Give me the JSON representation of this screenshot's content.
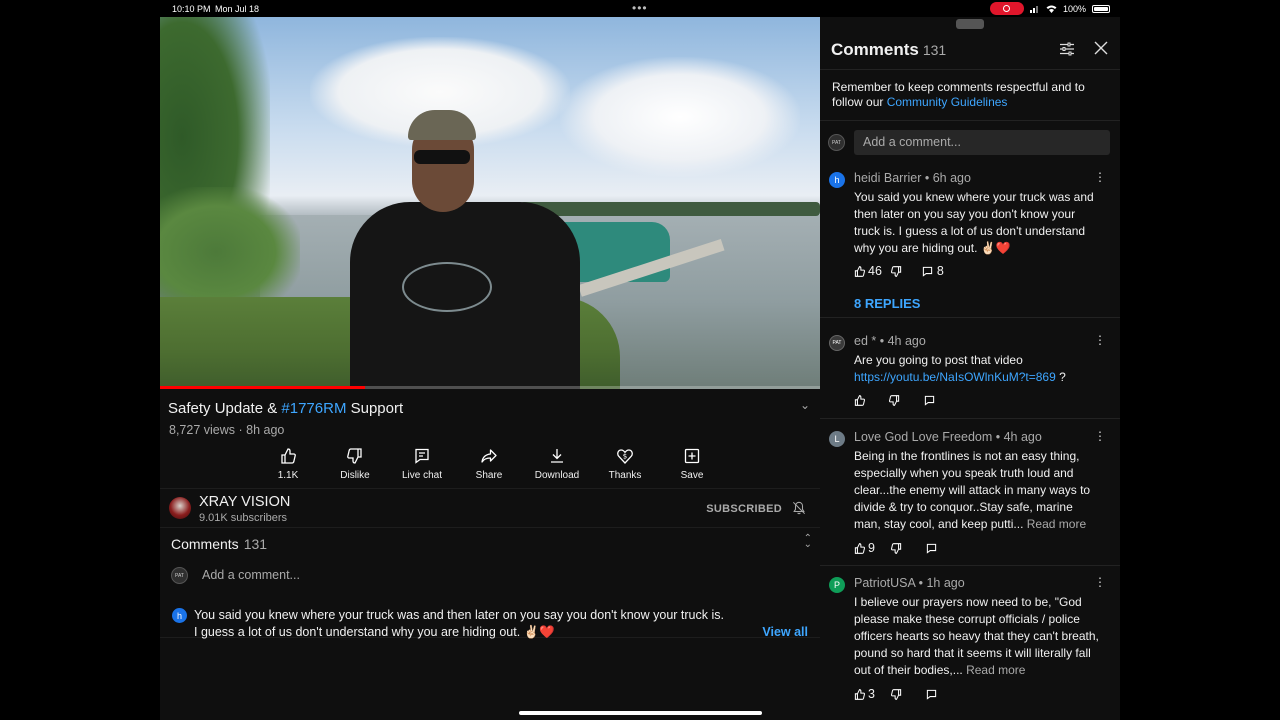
{
  "status": {
    "time": "10:10 PM",
    "date": "Mon Jul 18",
    "battery": "100%"
  },
  "video": {
    "progress_percent": 31,
    "title_prefix": "Safety Update & ",
    "title_tag": "#1776RM",
    "title_suffix": " Support",
    "meta": "8,727 views · 8h ago"
  },
  "actions": [
    {
      "label": "1.1K",
      "icon": "thumbs-up-icon"
    },
    {
      "label": "Dislike",
      "icon": "thumbs-down-icon"
    },
    {
      "label": "Live chat",
      "icon": "chat-icon"
    },
    {
      "label": "Share",
      "icon": "share-icon"
    },
    {
      "label": "Download",
      "icon": "download-icon"
    },
    {
      "label": "Thanks",
      "icon": "thanks-icon"
    },
    {
      "label": "Save",
      "icon": "save-icon"
    }
  ],
  "channel": {
    "name": "XRAY VISION",
    "subs": "9.01K subscribers",
    "subscribed_label": "SUBSCRIBED"
  },
  "comments_box": {
    "title": "Comments",
    "count": "131",
    "add_placeholder": "Add a comment...",
    "first_avatar_letter": "h",
    "first_text_line1": "You said you knew where your truck was and then later on you say you don't know your truck is.",
    "first_text_line2": "I guess a lot of us don't understand why you are hiding out. ✌🏻❤️",
    "view_all": "View all"
  },
  "panel": {
    "title": "Comments",
    "count": "131",
    "rules_text": "Remember to keep comments respectful and to follow our ",
    "rules_link": "Community Guidelines",
    "add_placeholder": "Add a comment...",
    "comments": [
      {
        "avatar_letter": "h",
        "avatar_color": "#1a73e8",
        "author": "heidi Barrier • 6h ago",
        "text": "You said you knew where your truck was and then later on you say you don't know your truck is.  I guess a lot of us don't understand why you are hiding out. ✌🏻❤️",
        "likes": "46",
        "reply_count": "8",
        "replies_label": "8 REPLIES"
      },
      {
        "avatar_letter": "",
        "avatar_color": "#3a3a3a",
        "author": "ed * • 4h ago",
        "text": "Are you going to post that video ",
        "link": "https://youtu.be/NaIsOWlnKuM?t=869",
        "text_after": " ?",
        "likes": "",
        "reply_count": ""
      },
      {
        "avatar_letter": "L",
        "avatar_color": "#6d7b86",
        "author": "Love God Love Freedom • 4h ago",
        "text": "Being in the frontlines is not an easy thing, especially when you speak truth loud and clear...the enemy will attack in many ways to divide & try to conquor..Stay safe, marine man, stay cool, and keep putti... ",
        "more": "Read more",
        "likes": "9",
        "reply_count": ""
      },
      {
        "avatar_letter": "P",
        "avatar_color": "#0f9d58",
        "author": "PatriotUSA • 1h ago",
        "text": "I believe our prayers now need to be, \"God please make these corrupt officials / police officers hearts so heavy that they can't breath, pound so hard that it seems it will literally fall out of their bodies,... ",
        "more": "Read more",
        "likes": "3",
        "reply_count": ""
      }
    ]
  }
}
